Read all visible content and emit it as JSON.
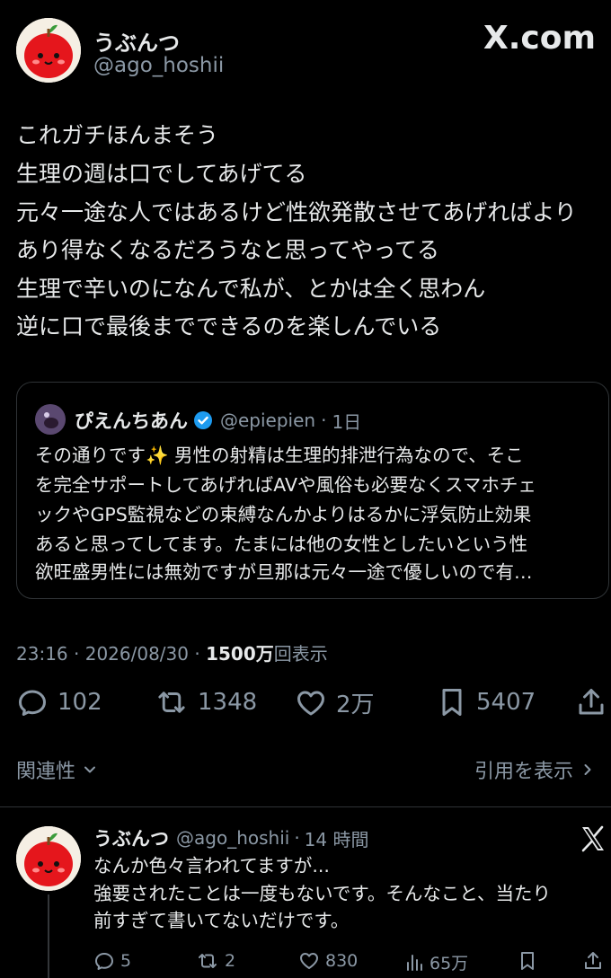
{
  "brand": {
    "logo_text": "X.com"
  },
  "main_tweet": {
    "author_name": "うぶんつ",
    "author_handle": "@ago_hoshii",
    "lines": [
      "これガチほんまそう",
      "生理の週は口でしてあげてる",
      "元々一途な人ではあるけど性欲発散させてあげればより",
      "あり得なくなるだろうなと思ってやってる",
      "生理で辛いのになんで私が、とかは全く思わん",
      "逆に口で最後までできるのを楽しんでいる"
    ],
    "meta": {
      "time": "23:16",
      "sep1": "·",
      "date": "2026/08/30",
      "sep2": "·",
      "views": "1500",
      "views_unit": "万",
      "views_label": "回表示"
    },
    "actions": {
      "replies": "102",
      "retweets": "1348",
      "likes": "2万",
      "bookmarks": "5407"
    }
  },
  "quoted_tweet": {
    "author_name": "ぴえんちあん",
    "author_handle": "@epiepien",
    "sep": "·",
    "time": "1日",
    "lines": [
      "その通りです✨ 男性の射精は生理的排泄行為なので、そこ",
      "を完全サポートしてあげればAVや風俗も必要なくスマホチェ",
      "ックやGPS監視などの束縛なんかよりはるかに浮気防止効果",
      "あると思ってしてます。たまには他の女性としたいという性",
      "欲旺盛男性には無効ですが旦那は元々一途で優しいので有…"
    ]
  },
  "related_bar": {
    "related_label": "関連性",
    "show_quotes_label": "引用を表示"
  },
  "reply_tweet": {
    "author_name": "うぶんつ",
    "author_handle": "@ago_hoshii",
    "sep": "·",
    "time": "14 時間",
    "lines": [
      "なんか色々言われてますが...",
      "強要されたことは一度もないです。そんなこと、当たり",
      "前すぎて書いてないだけです。"
    ],
    "actions": {
      "replies": "5",
      "retweets": "2",
      "likes": "830",
      "views": "65万"
    }
  },
  "colors": {
    "background": "#000000",
    "text": "#e7e9ea",
    "secondary": "#8b98a5",
    "verified": "#1d9bf0",
    "avatar_red": "#e5161c"
  }
}
